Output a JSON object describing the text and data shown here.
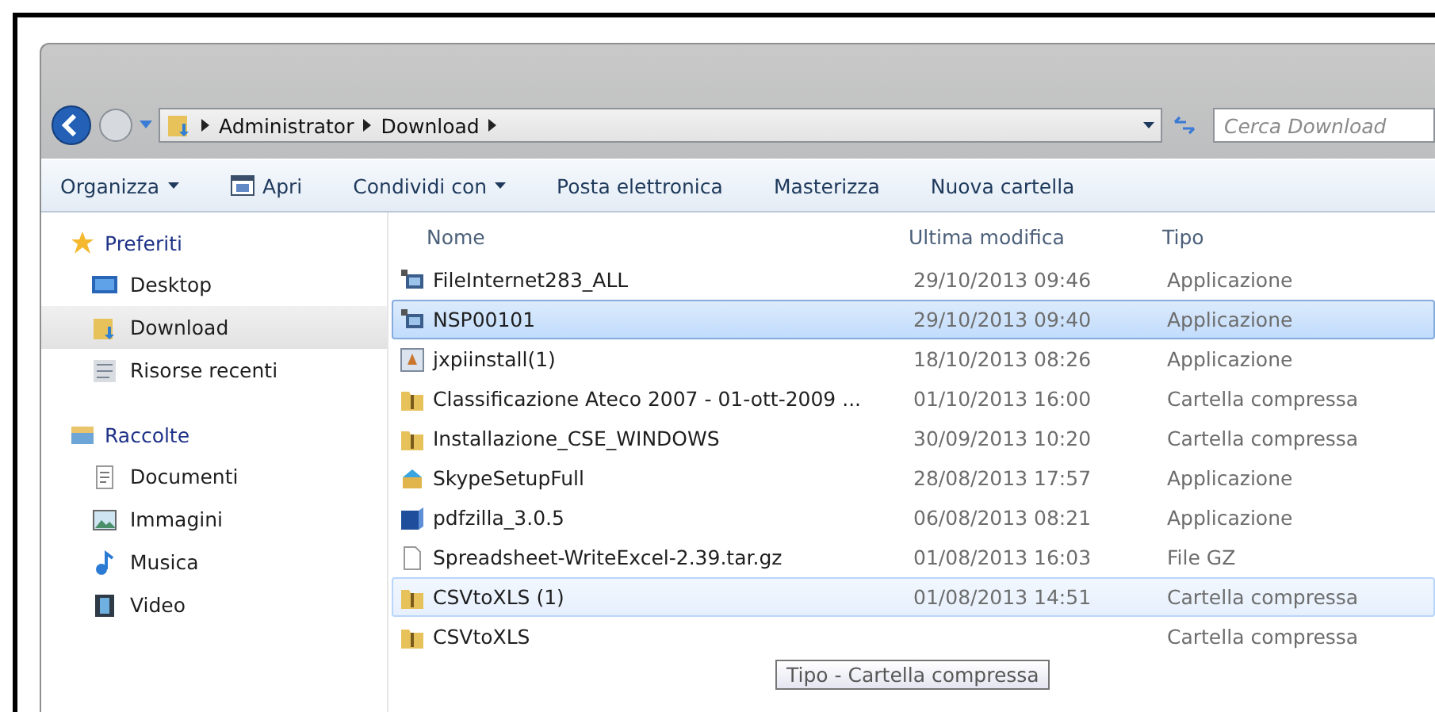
{
  "address_bar": {
    "crumbs": [
      "Administrator",
      "Download"
    ]
  },
  "search": {
    "placeholder": "Cerca Download"
  },
  "toolbar": [
    {
      "label": "Organizza",
      "dropdown": true,
      "icon": false
    },
    {
      "label": "Apri",
      "dropdown": false,
      "icon": true
    },
    {
      "label": "Condividi con",
      "dropdown": true,
      "icon": false
    },
    {
      "label": "Posta elettronica",
      "dropdown": false,
      "icon": false
    },
    {
      "label": "Masterizza",
      "dropdown": false,
      "icon": false
    },
    {
      "label": "Nuova cartella",
      "dropdown": false,
      "icon": false
    }
  ],
  "sidebar": {
    "groups": [
      {
        "label": "Preferiti",
        "kind": "star",
        "items": [
          {
            "label": "Desktop",
            "kind": "desktop",
            "selected": false
          },
          {
            "label": "Download",
            "kind": "download",
            "selected": true
          },
          {
            "label": "Risorse recenti",
            "kind": "recent",
            "selected": false
          }
        ]
      },
      {
        "label": "Raccolte",
        "kind": "library",
        "items": [
          {
            "label": "Documenti",
            "kind": "document",
            "selected": false
          },
          {
            "label": "Immagini",
            "kind": "picture",
            "selected": false
          },
          {
            "label": "Musica",
            "kind": "music",
            "selected": false
          },
          {
            "label": "Video",
            "kind": "video",
            "selected": false
          }
        ]
      }
    ]
  },
  "table": {
    "columns": [
      "Nome",
      "Ultima modifica",
      "Tipo"
    ],
    "rows": [
      {
        "name": "FileInternet283_ALL",
        "date": "29/10/2013 09:46",
        "type": "Applicazione",
        "kind": "exe",
        "selected": false,
        "hovered": false
      },
      {
        "name": "NSP00101",
        "date": "29/10/2013 09:40",
        "type": "Applicazione",
        "kind": "exe",
        "selected": true,
        "hovered": false
      },
      {
        "name": "jxpiinstall(1)",
        "date": "18/10/2013 08:26",
        "type": "Applicazione",
        "kind": "installer",
        "selected": false,
        "hovered": false
      },
      {
        "name": "Classificazione Ateco 2007 - 01-ott-2009 ...",
        "date": "01/10/2013 16:00",
        "type": "Cartella compressa",
        "kind": "archive",
        "selected": false,
        "hovered": false
      },
      {
        "name": "Installazione_CSE_WINDOWS",
        "date": "30/09/2013 10:20",
        "type": "Cartella compressa",
        "kind": "archive",
        "selected": false,
        "hovered": false
      },
      {
        "name": "SkypeSetupFull",
        "date": "28/08/2013 17:57",
        "type": "Applicazione",
        "kind": "setup",
        "selected": false,
        "hovered": false
      },
      {
        "name": "pdfzilla_3.0.5",
        "date": "06/08/2013 08:21",
        "type": "Applicazione",
        "kind": "box",
        "selected": false,
        "hovered": false
      },
      {
        "name": "Spreadsheet-WriteExcel-2.39.tar.gz",
        "date": "01/08/2013 16:03",
        "type": "File GZ",
        "kind": "file",
        "selected": false,
        "hovered": false
      },
      {
        "name": "CSVtoXLS (1)",
        "date": "01/08/2013 14:51",
        "type": "Cartella compressa",
        "kind": "archive",
        "selected": false,
        "hovered": true
      },
      {
        "name": "CSVtoXLS",
        "type": "Cartella compressa",
        "kind": "archive",
        "selected": false,
        "hovered": false
      }
    ]
  },
  "tooltip": {
    "text": "Tipo - Cartella compressa"
  }
}
